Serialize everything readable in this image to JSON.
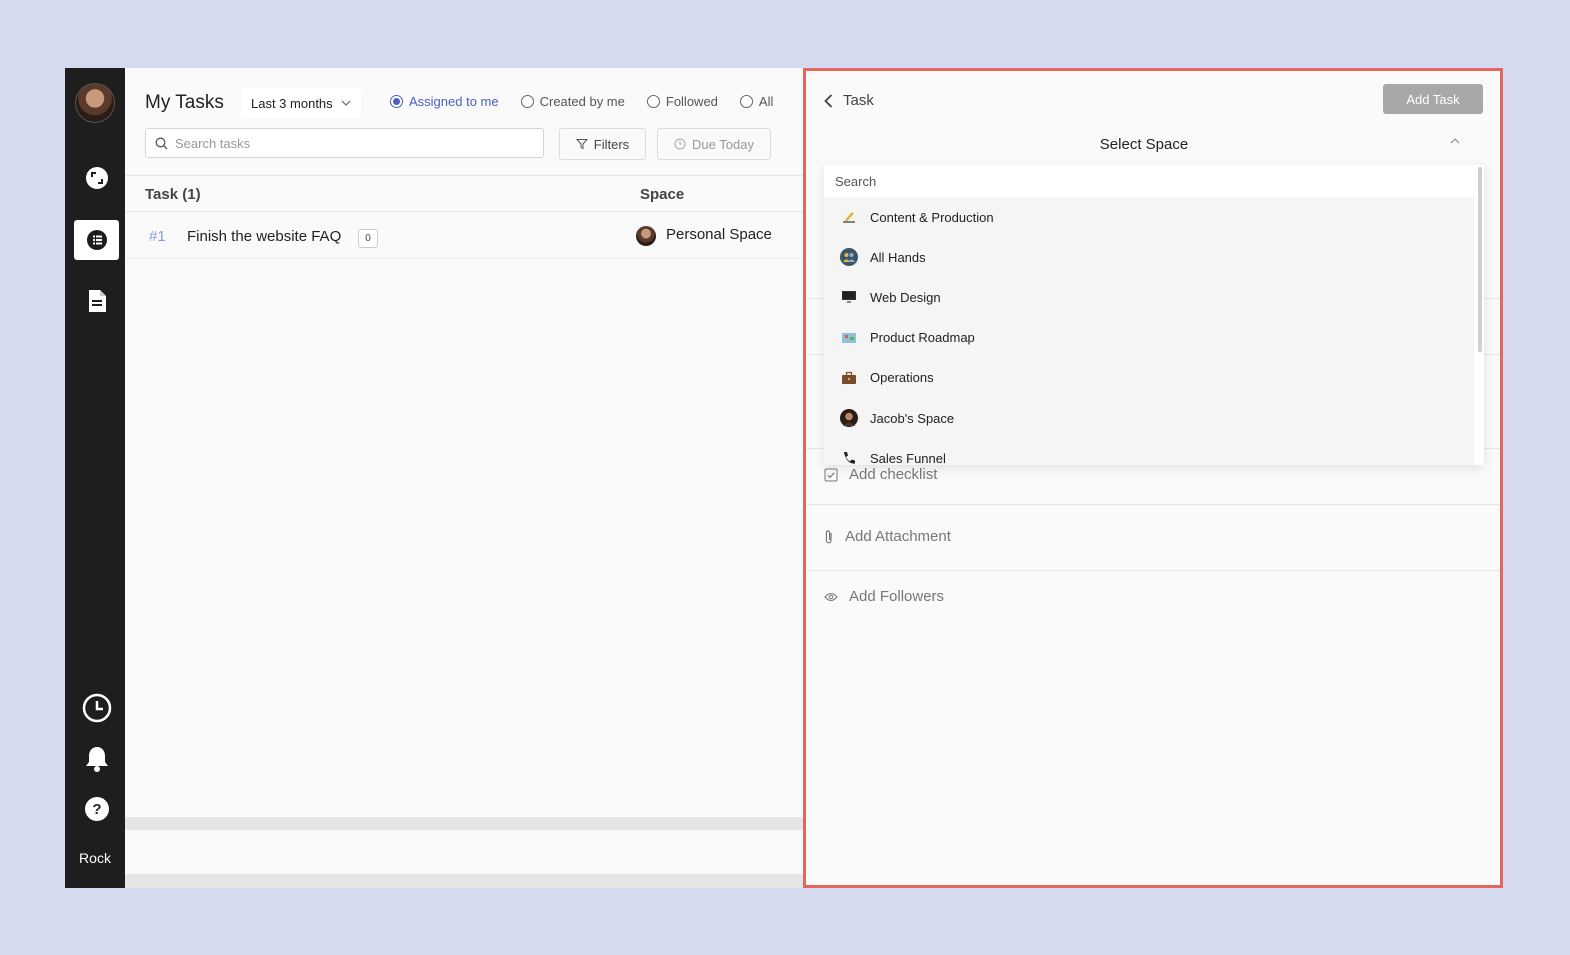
{
  "app_name": "Rock",
  "main": {
    "title": "My Tasks",
    "range_select": "Last 3 months",
    "filters": [
      {
        "label": "Assigned to me",
        "selected": true
      },
      {
        "label": "Created by me",
        "selected": false
      },
      {
        "label": "Followed",
        "selected": false
      },
      {
        "label": "All",
        "selected": false
      }
    ],
    "search_placeholder": "Search tasks",
    "filters_button": "Filters",
    "due_today_button": "Due Today",
    "columns": {
      "task": "Task (1)",
      "space": "Space"
    },
    "tasks": [
      {
        "number": "#1",
        "name": "Finish the website FAQ",
        "comments": "0",
        "space": "Personal Space"
      }
    ]
  },
  "panel": {
    "back_label": "Task",
    "add_task_button": "Add Task",
    "select_space_title": "Select Space",
    "dropdown_search_placeholder": "Search",
    "spaces": [
      {
        "name": "Content & Production",
        "icon": "writing-hand-icon"
      },
      {
        "name": "All Hands",
        "icon": "people-icon"
      },
      {
        "name": "Web Design",
        "icon": "monitor-icon"
      },
      {
        "name": "Product Roadmap",
        "icon": "map-icon"
      },
      {
        "name": "Operations",
        "icon": "briefcase-icon"
      },
      {
        "name": "Jacob's Space",
        "icon": "avatar-icon"
      },
      {
        "name": "Sales Funnel",
        "icon": "phone-icon"
      }
    ],
    "add_checklist": "Add checklist",
    "add_attachment": "Add Attachment",
    "add_followers": "Add Followers"
  },
  "colors": {
    "accent": "#4a5fc1",
    "panel_border": "#e4665c",
    "sidebar": "#1e1e1e",
    "background": "#d6daee"
  }
}
